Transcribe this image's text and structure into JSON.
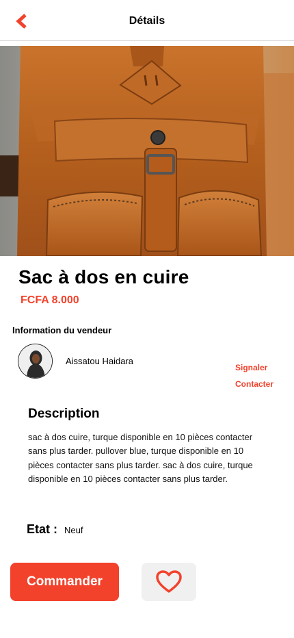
{
  "colors": {
    "accent": "#f2422c",
    "fav_bg": "#f0f0f0"
  },
  "header": {
    "title": "Détails",
    "back_icon": "chevron-left-icon"
  },
  "product": {
    "image_subject": "",
    "title": "Sac à dos en cuire",
    "price": "FCFA 8.000"
  },
  "seller": {
    "heading": "Information du vendeur",
    "name": "Aissatou Haidara",
    "report_label": "Signaler",
    "contact_label": "Contacter"
  },
  "description": {
    "heading": "Description",
    "text": "sac à dos cuire, turque  disponible en 10 pièces contacter sans plus tarder. pullover blue, turque disponible en 10 pièces contacter sans plus tarder. sac à dos cuire, turque  disponible en 10 pièces contacter sans plus tarder."
  },
  "state": {
    "label": "Etat :",
    "value": "Neuf"
  },
  "actions": {
    "order_label": "Commander",
    "favorite_icon": "heart-icon"
  }
}
